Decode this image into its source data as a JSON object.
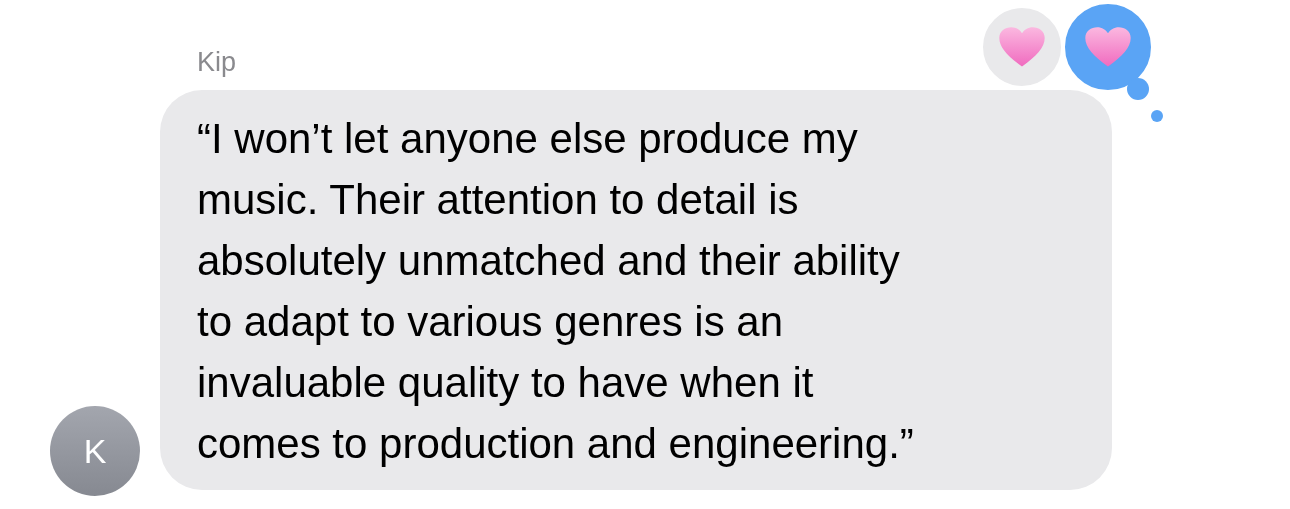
{
  "sender": {
    "name": "Kip",
    "initial": "K"
  },
  "message": {
    "lines": [
      "“I won’t let anyone else produce my",
      "music. Their attention to detail is",
      "absolutely unmatched and their ability",
      "to adapt to various genres is an",
      "invaluable quality to have when it",
      "comes to production and engineering.”"
    ]
  },
  "reactions": [
    {
      "selected": false
    },
    {
      "selected": true
    }
  ]
}
